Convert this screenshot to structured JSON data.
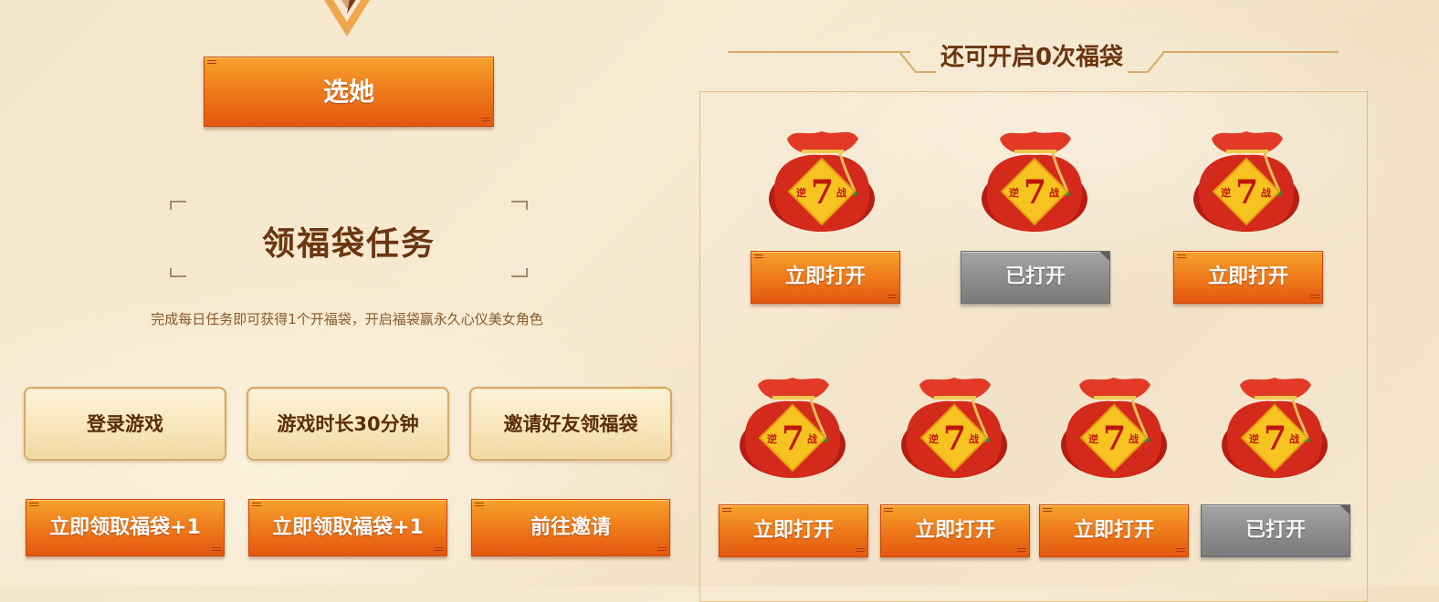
{
  "colors": {
    "accent_orange": "#ef7e1c",
    "title_brown": "#6b3510",
    "disabled_gray": "#8e8e8e",
    "bag_red": "#d42a1c",
    "tag_yellow": "#f6c320"
  },
  "select_button": {
    "label": "选她"
  },
  "task_section": {
    "title": "领福袋任务",
    "description": "完成每日任务即可获得1个开福袋，开启福袋赢永久心仪美女角色",
    "tasks": [
      {
        "name": "登录游戏",
        "button": "立即领取福袋+1"
      },
      {
        "name": "游戏时长30分钟",
        "button": "立即领取福袋+1"
      },
      {
        "name": "邀请好友领福袋",
        "button": "前往邀请"
      }
    ]
  },
  "bags_section": {
    "counter": "还可开启0次福袋",
    "bag_tag": {
      "number": "7",
      "left": "逆",
      "right": "战"
    },
    "bags": [
      {
        "button": "立即打开",
        "opened": false
      },
      {
        "button": "已打开",
        "opened": true
      },
      {
        "button": "立即打开",
        "opened": false
      },
      {
        "button": "立即打开",
        "opened": false
      },
      {
        "button": "立即打开",
        "opened": false
      },
      {
        "button": "立即打开",
        "opened": false
      },
      {
        "button": "已打开",
        "opened": true
      }
    ]
  }
}
